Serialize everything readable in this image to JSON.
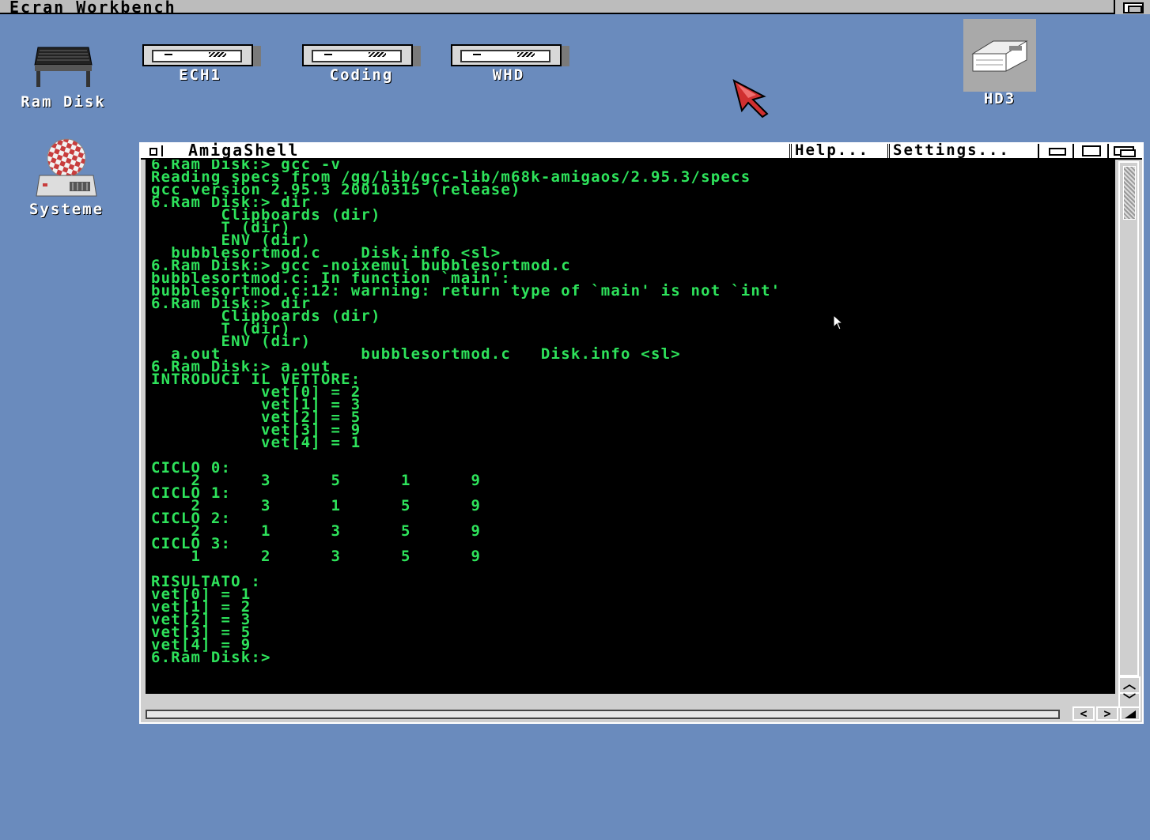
{
  "screen": {
    "title": "Ecran Workbench"
  },
  "icons": {
    "ram_disk": "Ram Disk",
    "ech1": "ECH1",
    "coding": "Coding",
    "whd": "WHD",
    "hd3": "HD3",
    "systeme": "Systeme"
  },
  "shell": {
    "title": "AmigaShell",
    "help": "Help...",
    "settings": "Settings...",
    "output": "6.Ram Disk:> gcc -v\nReading specs from /gg/lib/gcc-lib/m68k-amigaos/2.95.3/specs\ngcc version 2.95.3 20010315 (release)\n6.Ram Disk:> dir\n       Clipboards (dir)\n       T (dir)\n       ENV (dir)\n  bubblesortmod.c    Disk.info <sl>\n6.Ram Disk:> gcc -noixemul bubblesortmod.c\nbubblesortmod.c: In function `main':\nbubblesortmod.c:12: warning: return type of `main' is not `int'\n6.Ram Disk:> dir\n       Clipboards (dir)\n       T (dir)\n       ENV (dir)\n  a.out              bubblesortmod.c   Disk.info <sl>\n6.Ram Disk:> a.out\nINTRODUCI IL VETTORE:\n           vet[0] = 2\n           vet[1] = 3\n           vet[2] = 5\n           vet[3] = 9\n           vet[4] = 1\n\nCICLO 0:\n    2      3      5      1      9\nCICLO 1:\n    2      3      1      5      9\nCICLO 2:\n    2      1      3      5      9\nCICLO 3:\n    1      2      3      5      9\n\nRISULTATO :\nvet[0] = 1\nvet[1] = 2\nvet[2] = 3\nvet[3] = 5\nvet[4] = 9\n6.Ram Disk:>"
  },
  "colors": {
    "desktop": "#6a8bbd",
    "console_text": "#2ee35b",
    "console_bg": "#000000"
  }
}
